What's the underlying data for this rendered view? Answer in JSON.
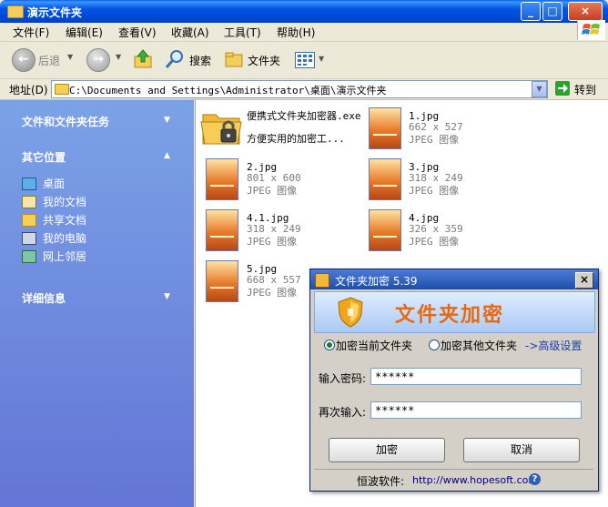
{
  "window": {
    "title": "演示文件夹",
    "controls": {
      "minimize": "_",
      "maximize": "□",
      "close": "×"
    }
  },
  "menubar": {
    "items": [
      "文件(F)",
      "编辑(E)",
      "查看(V)",
      "收藏(A)",
      "工具(T)",
      "帮助(H)"
    ]
  },
  "toolbar": {
    "back_label": "后退",
    "search_label": "搜索",
    "folders_label": "文件夹"
  },
  "address": {
    "label": "地址(D)",
    "path": "C:\\Documents and Settings\\Administrator\\桌面\\演示文件夹",
    "go_label": "转到"
  },
  "taskpane": {
    "tasks_title": "文件和文件夹任务",
    "other_title": "其它位置",
    "other_items": [
      "桌面",
      "我的文档",
      "共享文档",
      "我的电脑",
      "网上邻居"
    ],
    "details_title": "详细信息"
  },
  "files": [
    {
      "name": "便携式文件夹加密器.exe",
      "line2": "方便实用的加密工...",
      "type": "exe"
    },
    {
      "name": "1.jpg",
      "dims": "662 x 527",
      "kind": "JPEG 图像"
    },
    {
      "name": "2.jpg",
      "dims": "801 x 600",
      "kind": "JPEG 图像"
    },
    {
      "name": "3.jpg",
      "dims": "318 x 249",
      "kind": "JPEG 图像"
    },
    {
      "name": "4.1.jpg",
      "dims": "318 x 249",
      "kind": "JPEG 图像"
    },
    {
      "name": "4.jpg",
      "dims": "326 x 359",
      "kind": "JPEG 图像"
    },
    {
      "name": "5.jpg",
      "dims": "668 x 557",
      "kind": "JPEG 图像"
    }
  ],
  "dialog": {
    "title": "文件夹加密  5.39",
    "close": "×",
    "banner_title": "文件夹加密",
    "radio_current": "加密当前文件夹",
    "radio_other": "加密其他文件夹",
    "advanced": "->高级设置",
    "pwd_label": "输入密码:",
    "pwd_value": "******",
    "confirm_label": "再次输入:",
    "confirm_value": "******",
    "encrypt_button": "加密",
    "cancel_button": "取消",
    "footer_label": "恒波软件:",
    "footer_url": "http://www.hopesoft.com"
  },
  "colors": {
    "titlebar": "#0054e3",
    "taskpane": "#6f8ee0",
    "dialog_title": "#1e4ea8"
  }
}
